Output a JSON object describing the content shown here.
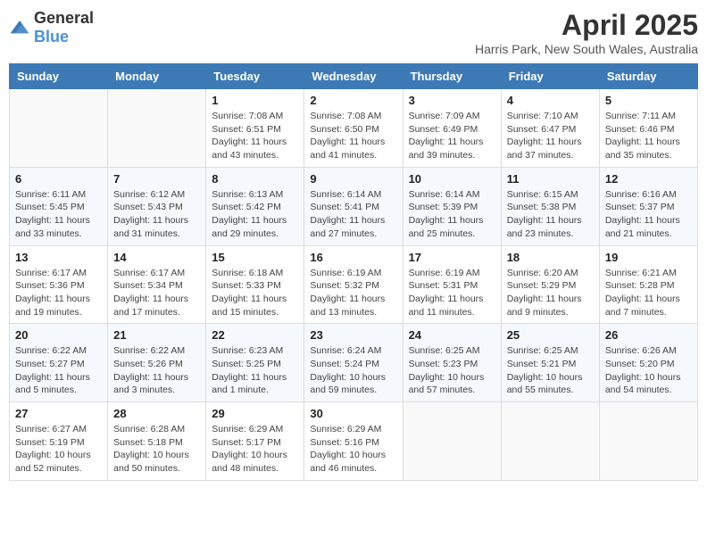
{
  "logo": {
    "general": "General",
    "blue": "Blue"
  },
  "header": {
    "month": "April 2025",
    "location": "Harris Park, New South Wales, Australia"
  },
  "weekdays": [
    "Sunday",
    "Monday",
    "Tuesday",
    "Wednesday",
    "Thursday",
    "Friday",
    "Saturday"
  ],
  "weeks": [
    [
      {
        "day": "",
        "sunrise": "",
        "sunset": "",
        "daylight": ""
      },
      {
        "day": "",
        "sunrise": "",
        "sunset": "",
        "daylight": ""
      },
      {
        "day": "1",
        "sunrise": "Sunrise: 7:08 AM",
        "sunset": "Sunset: 6:51 PM",
        "daylight": "Daylight: 11 hours and 43 minutes."
      },
      {
        "day": "2",
        "sunrise": "Sunrise: 7:08 AM",
        "sunset": "Sunset: 6:50 PM",
        "daylight": "Daylight: 11 hours and 41 minutes."
      },
      {
        "day": "3",
        "sunrise": "Sunrise: 7:09 AM",
        "sunset": "Sunset: 6:49 PM",
        "daylight": "Daylight: 11 hours and 39 minutes."
      },
      {
        "day": "4",
        "sunrise": "Sunrise: 7:10 AM",
        "sunset": "Sunset: 6:47 PM",
        "daylight": "Daylight: 11 hours and 37 minutes."
      },
      {
        "day": "5",
        "sunrise": "Sunrise: 7:11 AM",
        "sunset": "Sunset: 6:46 PM",
        "daylight": "Daylight: 11 hours and 35 minutes."
      }
    ],
    [
      {
        "day": "6",
        "sunrise": "Sunrise: 6:11 AM",
        "sunset": "Sunset: 5:45 PM",
        "daylight": "Daylight: 11 hours and 33 minutes."
      },
      {
        "day": "7",
        "sunrise": "Sunrise: 6:12 AM",
        "sunset": "Sunset: 5:43 PM",
        "daylight": "Daylight: 11 hours and 31 minutes."
      },
      {
        "day": "8",
        "sunrise": "Sunrise: 6:13 AM",
        "sunset": "Sunset: 5:42 PM",
        "daylight": "Daylight: 11 hours and 29 minutes."
      },
      {
        "day": "9",
        "sunrise": "Sunrise: 6:14 AM",
        "sunset": "Sunset: 5:41 PM",
        "daylight": "Daylight: 11 hours and 27 minutes."
      },
      {
        "day": "10",
        "sunrise": "Sunrise: 6:14 AM",
        "sunset": "Sunset: 5:39 PM",
        "daylight": "Daylight: 11 hours and 25 minutes."
      },
      {
        "day": "11",
        "sunrise": "Sunrise: 6:15 AM",
        "sunset": "Sunset: 5:38 PM",
        "daylight": "Daylight: 11 hours and 23 minutes."
      },
      {
        "day": "12",
        "sunrise": "Sunrise: 6:16 AM",
        "sunset": "Sunset: 5:37 PM",
        "daylight": "Daylight: 11 hours and 21 minutes."
      }
    ],
    [
      {
        "day": "13",
        "sunrise": "Sunrise: 6:17 AM",
        "sunset": "Sunset: 5:36 PM",
        "daylight": "Daylight: 11 hours and 19 minutes."
      },
      {
        "day": "14",
        "sunrise": "Sunrise: 6:17 AM",
        "sunset": "Sunset: 5:34 PM",
        "daylight": "Daylight: 11 hours and 17 minutes."
      },
      {
        "day": "15",
        "sunrise": "Sunrise: 6:18 AM",
        "sunset": "Sunset: 5:33 PM",
        "daylight": "Daylight: 11 hours and 15 minutes."
      },
      {
        "day": "16",
        "sunrise": "Sunrise: 6:19 AM",
        "sunset": "Sunset: 5:32 PM",
        "daylight": "Daylight: 11 hours and 13 minutes."
      },
      {
        "day": "17",
        "sunrise": "Sunrise: 6:19 AM",
        "sunset": "Sunset: 5:31 PM",
        "daylight": "Daylight: 11 hours and 11 minutes."
      },
      {
        "day": "18",
        "sunrise": "Sunrise: 6:20 AM",
        "sunset": "Sunset: 5:29 PM",
        "daylight": "Daylight: 11 hours and 9 minutes."
      },
      {
        "day": "19",
        "sunrise": "Sunrise: 6:21 AM",
        "sunset": "Sunset: 5:28 PM",
        "daylight": "Daylight: 11 hours and 7 minutes."
      }
    ],
    [
      {
        "day": "20",
        "sunrise": "Sunrise: 6:22 AM",
        "sunset": "Sunset: 5:27 PM",
        "daylight": "Daylight: 11 hours and 5 minutes."
      },
      {
        "day": "21",
        "sunrise": "Sunrise: 6:22 AM",
        "sunset": "Sunset: 5:26 PM",
        "daylight": "Daylight: 11 hours and 3 minutes."
      },
      {
        "day": "22",
        "sunrise": "Sunrise: 6:23 AM",
        "sunset": "Sunset: 5:25 PM",
        "daylight": "Daylight: 11 hours and 1 minute."
      },
      {
        "day": "23",
        "sunrise": "Sunrise: 6:24 AM",
        "sunset": "Sunset: 5:24 PM",
        "daylight": "Daylight: 10 hours and 59 minutes."
      },
      {
        "day": "24",
        "sunrise": "Sunrise: 6:25 AM",
        "sunset": "Sunset: 5:23 PM",
        "daylight": "Daylight: 10 hours and 57 minutes."
      },
      {
        "day": "25",
        "sunrise": "Sunrise: 6:25 AM",
        "sunset": "Sunset: 5:21 PM",
        "daylight": "Daylight: 10 hours and 55 minutes."
      },
      {
        "day": "26",
        "sunrise": "Sunrise: 6:26 AM",
        "sunset": "Sunset: 5:20 PM",
        "daylight": "Daylight: 10 hours and 54 minutes."
      }
    ],
    [
      {
        "day": "27",
        "sunrise": "Sunrise: 6:27 AM",
        "sunset": "Sunset: 5:19 PM",
        "daylight": "Daylight: 10 hours and 52 minutes."
      },
      {
        "day": "28",
        "sunrise": "Sunrise: 6:28 AM",
        "sunset": "Sunset: 5:18 PM",
        "daylight": "Daylight: 10 hours and 50 minutes."
      },
      {
        "day": "29",
        "sunrise": "Sunrise: 6:29 AM",
        "sunset": "Sunset: 5:17 PM",
        "daylight": "Daylight: 10 hours and 48 minutes."
      },
      {
        "day": "30",
        "sunrise": "Sunrise: 6:29 AM",
        "sunset": "Sunset: 5:16 PM",
        "daylight": "Daylight: 10 hours and 46 minutes."
      },
      {
        "day": "",
        "sunrise": "",
        "sunset": "",
        "daylight": ""
      },
      {
        "day": "",
        "sunrise": "",
        "sunset": "",
        "daylight": ""
      },
      {
        "day": "",
        "sunrise": "",
        "sunset": "",
        "daylight": ""
      }
    ]
  ]
}
